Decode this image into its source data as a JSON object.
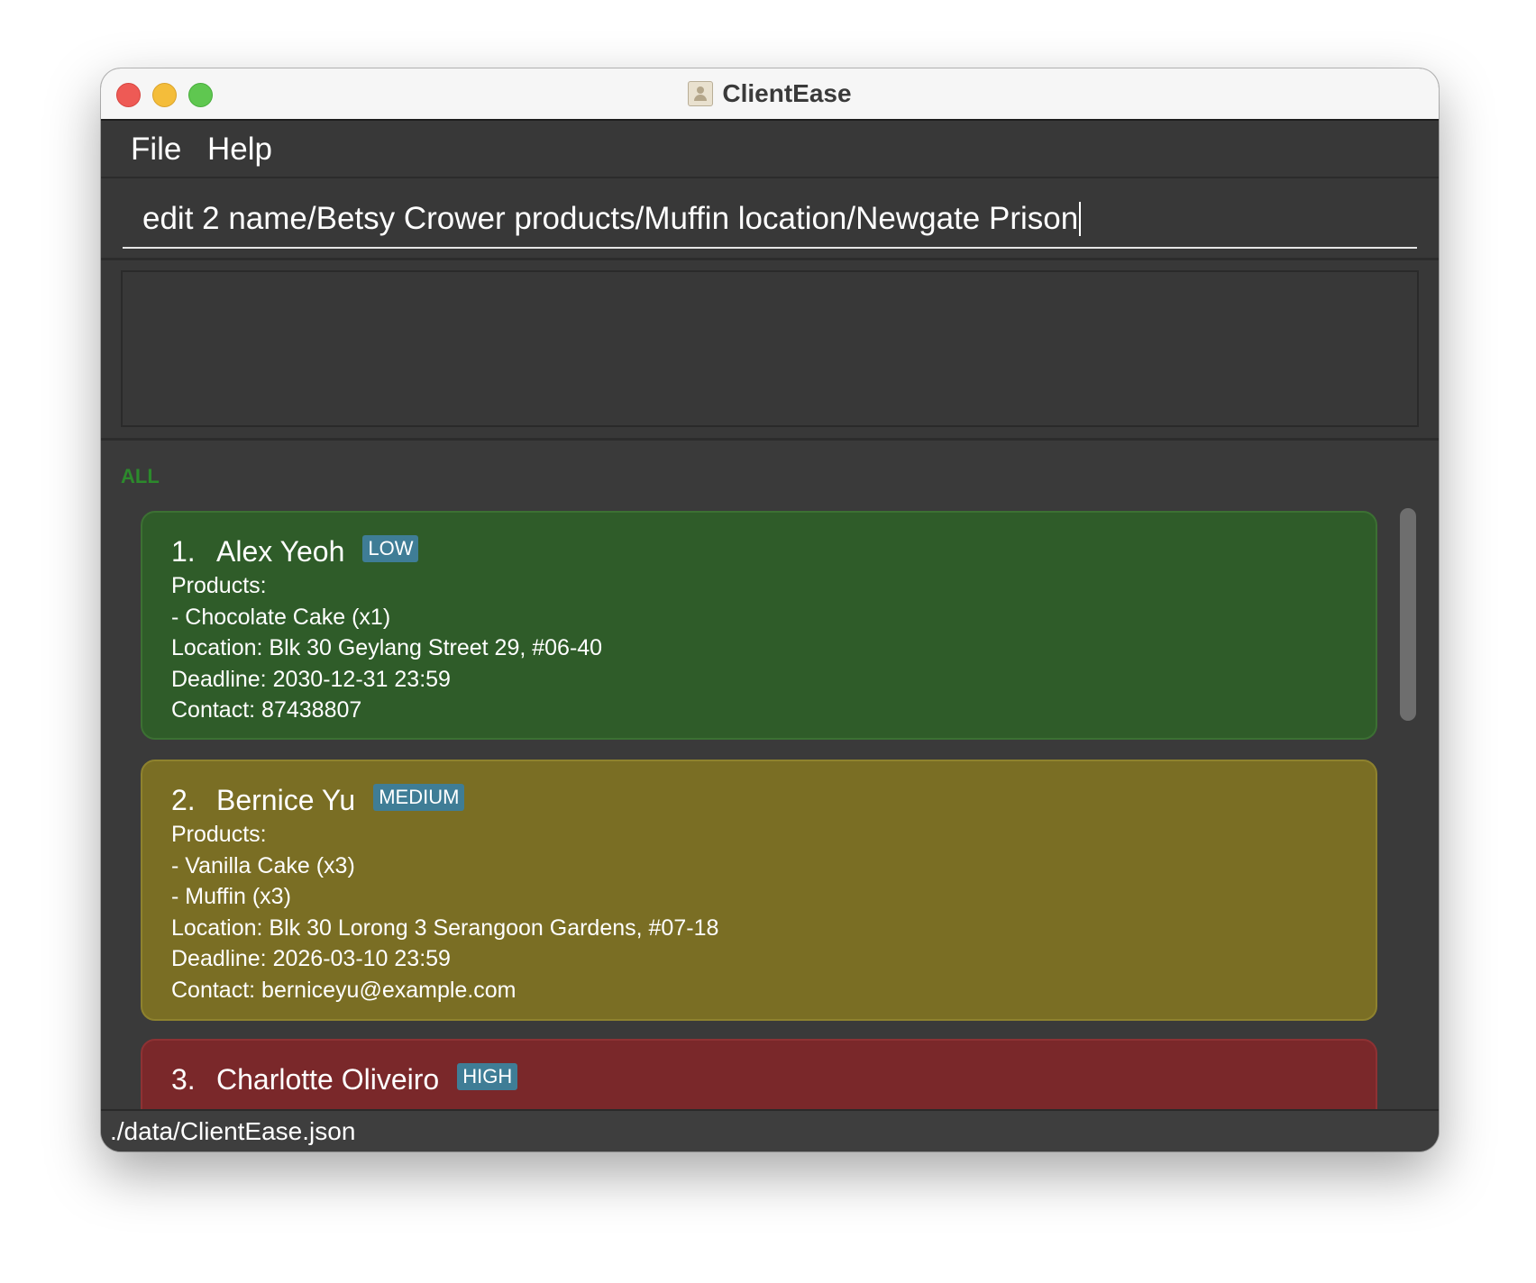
{
  "window": {
    "title": "ClientEase"
  },
  "menu": {
    "file_label": "File",
    "help_label": "Help"
  },
  "command": {
    "value": "edit 2 name/Betsy Crower products/Muffin location/Newgate Prison"
  },
  "result": {
    "text": ""
  },
  "list": {
    "filter_label": "ALL",
    "clients": [
      {
        "index": "1.",
        "name": "Alex Yeoh",
        "priority": "LOW",
        "products_header": "Products:",
        "products": [
          "- Chocolate Cake (x1)"
        ],
        "location": "Location: Blk 30 Geylang Street 29, #06-40",
        "deadline": "Deadline: 2030-12-31 23:59",
        "contact": "Contact: 87438807",
        "color": "#2f5c29"
      },
      {
        "index": "2.",
        "name": "Bernice Yu",
        "priority": "MEDIUM",
        "products_header": "Products:",
        "products": [
          "- Vanilla Cake (x3)",
          "- Muffin (x3)"
        ],
        "location": "Location: Blk 30 Lorong 3 Serangoon Gardens, #07-18",
        "deadline": "Deadline: 2026-03-10 23:59",
        "contact": "Contact: berniceyu@example.com",
        "color": "#7a6e24"
      },
      {
        "index": "3.",
        "name": "Charlotte Oliveiro",
        "priority": "HIGH",
        "color": "#7a282a"
      }
    ]
  },
  "status": {
    "file_path": "./data/ClientEase.json"
  },
  "icons": {
    "app": "contact-book-icon"
  }
}
